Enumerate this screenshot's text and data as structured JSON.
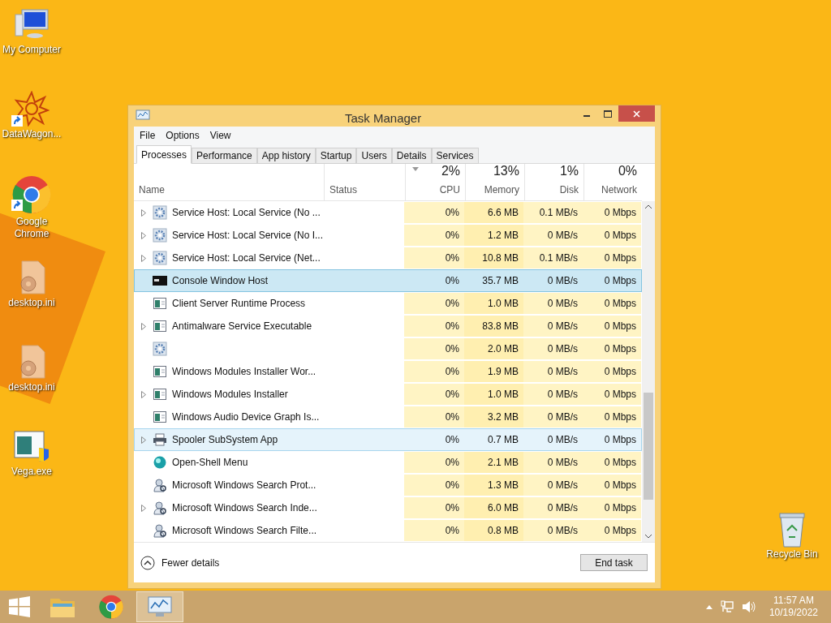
{
  "desktop_icons": [
    {
      "label": "My Computer",
      "kind": "computer",
      "shortcut": false
    },
    {
      "label": "DataWagon...",
      "kind": "star",
      "shortcut": true
    },
    {
      "label": "Google Chrome",
      "kind": "chrome",
      "shortcut": true
    },
    {
      "label": "desktop.ini",
      "kind": "file",
      "shortcut": false
    },
    {
      "label": "desktop.ini",
      "kind": "file",
      "shortcut": false
    },
    {
      "label": "Vega.exe",
      "kind": "exe",
      "shortcut": false
    }
  ],
  "recycle_bin": {
    "label": "Recycle Bin"
  },
  "window": {
    "title": "Task Manager",
    "menu": [
      "File",
      "Options",
      "View"
    ],
    "tabs": [
      {
        "label": "Processes",
        "selected": true
      },
      {
        "label": "Performance",
        "selected": false
      },
      {
        "label": "App history",
        "selected": false
      },
      {
        "label": "Startup",
        "selected": false
      },
      {
        "label": "Users",
        "selected": false
      },
      {
        "label": "Details",
        "selected": false
      },
      {
        "label": "Services",
        "selected": false
      }
    ],
    "columns": [
      {
        "label": "Name"
      },
      {
        "label": "Status"
      },
      {
        "label": "CPU",
        "percent": "2%"
      },
      {
        "label": "Memory",
        "percent": "13%"
      },
      {
        "label": "Disk",
        "percent": "1%"
      },
      {
        "label": "Network",
        "percent": "0%"
      }
    ],
    "rows": [
      {
        "expandable": true,
        "kind": "gear",
        "name": "Service Host: Local Service (No ...",
        "cpu": "0%",
        "memory": "6.6 MB",
        "disk": "0.1 MB/s",
        "network": "0 Mbps",
        "selected": false,
        "hovered": false
      },
      {
        "expandable": true,
        "kind": "gear",
        "name": "Service Host: Local Service (No I...",
        "cpu": "0%",
        "memory": "1.2 MB",
        "disk": "0 MB/s",
        "network": "0 Mbps",
        "selected": false,
        "hovered": false
      },
      {
        "expandable": true,
        "kind": "gear",
        "name": "Service Host: Local Service (Net...",
        "cpu": "0%",
        "memory": "10.8 MB",
        "disk": "0.1 MB/s",
        "network": "0 Mbps",
        "selected": false,
        "hovered": false
      },
      {
        "expandable": false,
        "kind": "console",
        "name": "Console Window Host",
        "cpu": "0%",
        "memory": "35.7 MB",
        "disk": "0 MB/s",
        "network": "0 Mbps",
        "selected": true,
        "hovered": false
      },
      {
        "expandable": false,
        "kind": "app",
        "name": "Client Server Runtime Process",
        "cpu": "0%",
        "memory": "1.0 MB",
        "disk": "0 MB/s",
        "network": "0 Mbps",
        "selected": false,
        "hovered": false
      },
      {
        "expandable": true,
        "kind": "app",
        "name": "Antimalware Service Executable",
        "cpu": "0%",
        "memory": "83.8 MB",
        "disk": "0 MB/s",
        "network": "0 Mbps",
        "selected": false,
        "hovered": false
      },
      {
        "expandable": false,
        "kind": "gear",
        "cpu": "0%",
        "memory": "2.0 MB",
        "disk": "0 MB/s",
        "network": "0 Mbps",
        "selected": false,
        "hovered": false
      },
      {
        "expandable": false,
        "kind": "app",
        "name": "Windows Modules Installer Wor...",
        "cpu": "0%",
        "memory": "1.9 MB",
        "disk": "0 MB/s",
        "network": "0 Mbps",
        "selected": false,
        "hovered": false
      },
      {
        "expandable": true,
        "kind": "app",
        "name": "Windows Modules Installer",
        "cpu": "0%",
        "memory": "1.0 MB",
        "disk": "0 MB/s",
        "network": "0 Mbps",
        "selected": false,
        "hovered": false
      },
      {
        "expandable": false,
        "kind": "app",
        "name": "Windows Audio Device Graph Is...",
        "cpu": "0%",
        "memory": "3.2 MB",
        "disk": "0 MB/s",
        "network": "0 Mbps",
        "selected": false,
        "hovered": false
      },
      {
        "expandable": true,
        "kind": "printer",
        "name": "Spooler SubSystem App",
        "cpu": "0%",
        "memory": "0.7 MB",
        "disk": "0 MB/s",
        "network": "0 Mbps",
        "selected": false,
        "hovered": true
      },
      {
        "expandable": false,
        "kind": "shell",
        "name": "Open-Shell Menu",
        "cpu": "0%",
        "memory": "2.1 MB",
        "disk": "0 MB/s",
        "network": "0 Mbps",
        "selected": false,
        "hovered": false
      },
      {
        "expandable": false,
        "kind": "search",
        "name": "Microsoft Windows Search Prot...",
        "cpu": "0%",
        "memory": "1.3 MB",
        "disk": "0 MB/s",
        "network": "0 Mbps",
        "selected": false,
        "hovered": false
      },
      {
        "expandable": true,
        "kind": "search",
        "name": "Microsoft Windows Search Inde...",
        "cpu": "0%",
        "memory": "6.0 MB",
        "disk": "0 MB/s",
        "network": "0 Mbps",
        "selected": false,
        "hovered": false
      },
      {
        "expandable": false,
        "kind": "search",
        "name": "Microsoft Windows Search Filte...",
        "cpu": "0%",
        "memory": "0.8 MB",
        "disk": "0 MB/s",
        "network": "0 Mbps",
        "selected": false,
        "hovered": false
      }
    ],
    "fewer_details": "Fewer details",
    "end_task": "End task"
  },
  "taskbar": {
    "time": "11:57 AM",
    "date": "10/19/2022"
  }
}
